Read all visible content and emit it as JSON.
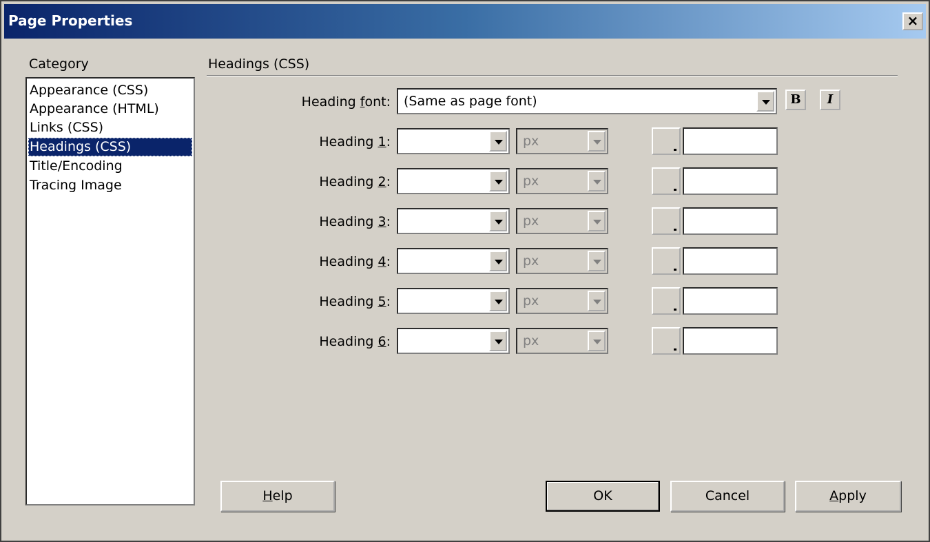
{
  "window": {
    "title": "Page Properties",
    "close_label": "×"
  },
  "category": {
    "label": "Category",
    "items": [
      {
        "label": "Appearance (CSS)",
        "selected": false
      },
      {
        "label": "Appearance (HTML)",
        "selected": false
      },
      {
        "label": "Links (CSS)",
        "selected": false
      },
      {
        "label": "Headings (CSS)",
        "selected": true
      },
      {
        "label": "Title/Encoding",
        "selected": false
      },
      {
        "label": "Tracing Image",
        "selected": false
      }
    ]
  },
  "section": {
    "title": "Headings (CSS)",
    "heading_font": {
      "label_pre": "Heading ",
      "label_key": "f",
      "label_post": "ont:",
      "value": "(Same as page font)",
      "bold_label": "B",
      "italic_label": "I"
    },
    "headings": [
      {
        "label_pre": "Heading ",
        "key": "1",
        "label_post": ":",
        "size": "",
        "unit": "px",
        "color": ""
      },
      {
        "label_pre": "Heading ",
        "key": "2",
        "label_post": ":",
        "size": "",
        "unit": "px",
        "color": ""
      },
      {
        "label_pre": "Heading ",
        "key": "3",
        "label_post": ":",
        "size": "",
        "unit": "px",
        "color": ""
      },
      {
        "label_pre": "Heading ",
        "key": "4",
        "label_post": ":",
        "size": "",
        "unit": "px",
        "color": ""
      },
      {
        "label_pre": "Heading ",
        "key": "5",
        "label_post": ":",
        "size": "",
        "unit": "px",
        "color": ""
      },
      {
        "label_pre": "Heading ",
        "key": "6",
        "label_post": ":",
        "size": "",
        "unit": "px",
        "color": ""
      }
    ]
  },
  "buttons": {
    "help": {
      "key": "H",
      "rest": "elp"
    },
    "ok": "OK",
    "cancel": "Cancel",
    "apply": {
      "key": "A",
      "rest": "pply"
    }
  }
}
